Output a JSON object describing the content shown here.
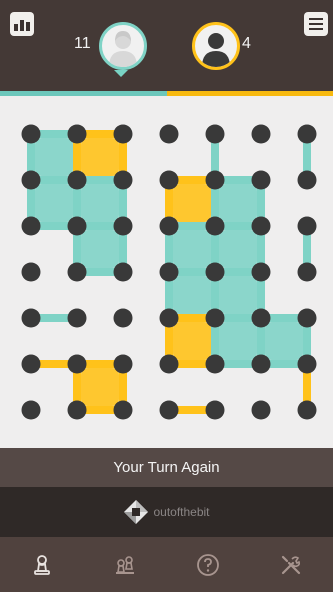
{
  "header": {
    "player1_score": "11",
    "player2_score": "4"
  },
  "progress": {
    "player1_fraction": 0.5,
    "player2_fraction": 0.5
  },
  "board": {
    "grid": {
      "cols": 7,
      "rows": 7
    },
    "colors": {
      "background": "#efeeee",
      "dot": "#393939",
      "player1": "#7fd3c6",
      "player2": "#ffc21a"
    },
    "boxes": [
      {
        "c": 0,
        "r": 0,
        "p": 1
      },
      {
        "c": 1,
        "r": 0,
        "p": 2
      },
      {
        "c": 0,
        "r": 1,
        "p": 1
      },
      {
        "c": 1,
        "r": 1,
        "p": 1
      },
      {
        "c": 1,
        "r": 2,
        "p": 1
      },
      {
        "c": 3,
        "r": 1,
        "p": 2
      },
      {
        "c": 4,
        "r": 1,
        "p": 1
      },
      {
        "c": 3,
        "r": 2,
        "p": 1
      },
      {
        "c": 4,
        "r": 2,
        "p": 1
      },
      {
        "c": 3,
        "r": 3,
        "p": 1
      },
      {
        "c": 4,
        "r": 3,
        "p": 1
      },
      {
        "c": 3,
        "r": 4,
        "p": 2
      },
      {
        "c": 4,
        "r": 4,
        "p": 1
      },
      {
        "c": 5,
        "r": 4,
        "p": 1
      },
      {
        "c": 1,
        "r": 5,
        "p": 2
      }
    ],
    "lines": [
      {
        "dir": "h",
        "c": 0,
        "r": 4,
        "p": 1
      },
      {
        "dir": "h",
        "c": 0,
        "r": 5,
        "p": 2
      },
      {
        "dir": "h",
        "c": 3,
        "r": 6,
        "p": 2
      },
      {
        "dir": "v",
        "c": 4,
        "r": 0,
        "p": 1
      },
      {
        "dir": "v",
        "c": 6,
        "r": 0,
        "p": 1
      },
      {
        "dir": "v",
        "c": 6,
        "r": 2,
        "p": 1
      },
      {
        "dir": "v",
        "c": 6,
        "r": 5,
        "p": 2
      }
    ]
  },
  "status": {
    "message": "Your Turn Again"
  },
  "ad": {
    "brand": "outofthebit"
  },
  "nav": {
    "items": [
      "single-player",
      "multiplayer",
      "help",
      "settings"
    ]
  }
}
